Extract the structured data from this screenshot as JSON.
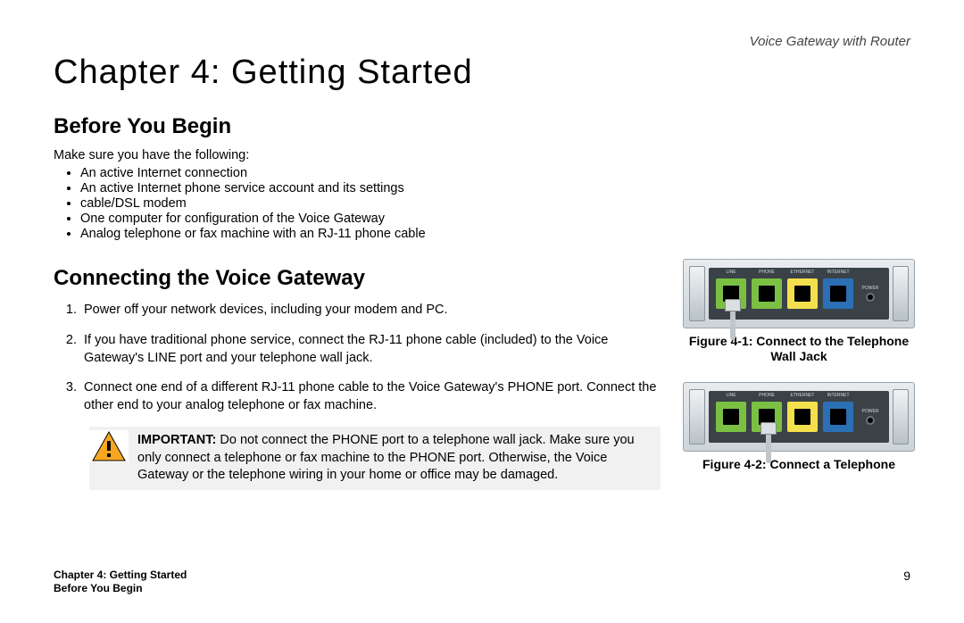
{
  "header": {
    "product": "Voice Gateway with Router"
  },
  "chapter": {
    "title": "Chapter 4: Getting Started"
  },
  "section1": {
    "heading": "Before You Begin",
    "intro": "Make sure you have the following:",
    "items": [
      "An active Internet connection",
      "An active Internet phone service account and its settings",
      "cable/DSL modem",
      "One computer for configuration of the Voice Gateway",
      "Analog telephone or fax machine with an RJ-11 phone cable"
    ]
  },
  "section2": {
    "heading": "Connecting the Voice Gateway",
    "steps": [
      "Power off your network devices, including your modem and PC.",
      "If you have traditional phone service, connect the RJ-11 phone cable (included) to the Voice Gateway's LINE port and your telephone wall jack.",
      "Connect one end of a different RJ-11 phone cable to the Voice Gateway's PHONE port. Connect the other end to your analog telephone or fax machine."
    ],
    "callout_label": "IMPORTANT:",
    "callout_body": "Do not connect the PHONE port to a telephone wall jack. Make sure you only connect a telephone or fax machine to the PHONE port. Otherwise, the Voice Gateway or the telephone wiring in your home or office may be damaged."
  },
  "figures": {
    "f1": {
      "caption_l1": "Figure 4-1: Connect to the Telephone",
      "caption_l2": "Wall Jack"
    },
    "f2": {
      "caption": "Figure 4-2: Connect a Telephone"
    }
  },
  "device_ports": {
    "p1": "LINE",
    "p2": "PHONE",
    "p3": "ETHERNET",
    "p4": "INTERNET",
    "pwr": "POWER"
  },
  "footer": {
    "l1": "Chapter 4: Getting Started",
    "l2": "Before You Begin",
    "page": "9"
  }
}
